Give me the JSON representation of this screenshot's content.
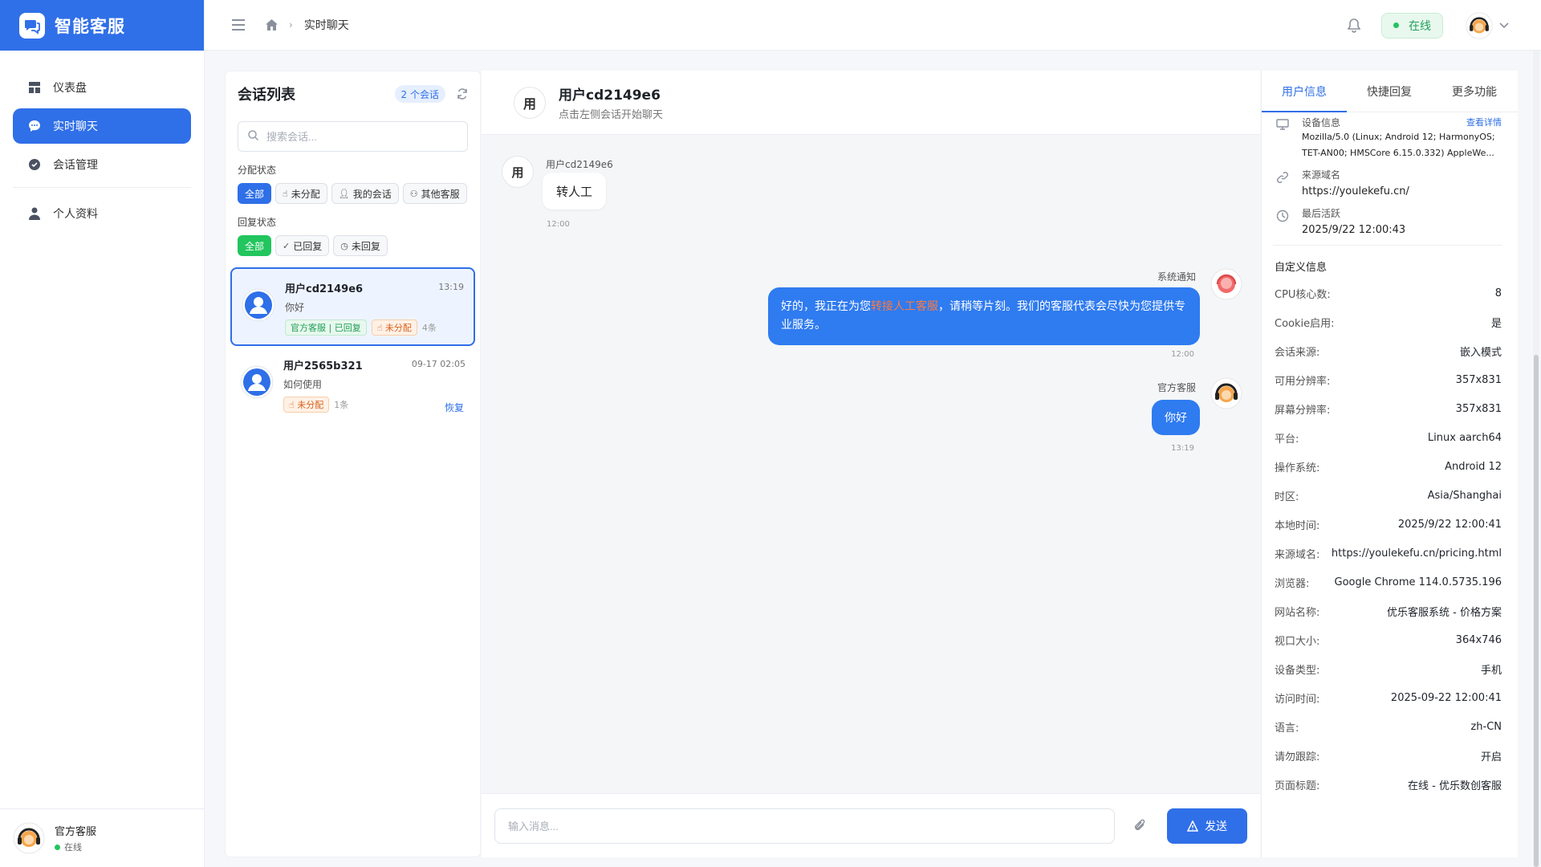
{
  "app": {
    "name": "智能客服"
  },
  "sidebar": {
    "items": [
      {
        "label": "仪表盘"
      },
      {
        "label": "实时聊天"
      },
      {
        "label": "会话管理"
      },
      {
        "label": "个人资料"
      }
    ],
    "footer": {
      "name": "官方客服",
      "status": "在线"
    }
  },
  "header": {
    "breadcrumb": "实时聊天",
    "status": "在线"
  },
  "conversations": {
    "title": "会话列表",
    "count": "2 个会话",
    "search_placeholder": "搜索会话...",
    "assign_label": "分配状态",
    "assign_filters": [
      "全部",
      "未分配",
      "我的会话",
      "其他客服"
    ],
    "reply_label": "回复状态",
    "reply_filters": [
      "全部",
      "已回复",
      "未回复"
    ],
    "items": [
      {
        "name": "用户cd2149e6",
        "time": "13:19",
        "message": "你好",
        "tag1": "官方客服 | 已回复",
        "tag2": "未分配",
        "count": "4条"
      },
      {
        "name": "用户2565b321",
        "time": "09-17 02:05",
        "message": "如何使用",
        "tag2": "未分配",
        "count": "1条",
        "action": "恢复"
      }
    ]
  },
  "chat": {
    "avatar_char": "用",
    "user_name": "用户cd2149e6",
    "subtitle": "点击左侧会话开始聊天",
    "messages": {
      "m1": {
        "sender": "用户cd2149e6",
        "text": "转人工",
        "time": "12:00"
      },
      "m2": {
        "sender": "系统通知",
        "text_a": "好的，我正在为您",
        "text_hl": "转接人工客服",
        "text_b": "，请稍等片刻。我们的客服代表会尽快为您提供专业服务。",
        "time": "12:00"
      },
      "m3": {
        "sender": "官方客服",
        "text": "你好",
        "time": "13:19"
      }
    },
    "input_placeholder": "输入消息...",
    "send_label": "发送"
  },
  "info": {
    "tabs": [
      "用户信息",
      "快捷回复",
      "更多功能"
    ],
    "device_label": "设备信息",
    "device_link": "查看详情",
    "device_ua": "Mozilla/5.0 (Linux; Android 12; HarmonyOS; TET-AN00; HMSCore 6.15.0.332) AppleWe...",
    "source_label": "来源域名",
    "source_value": "https://youlekefu.cn/",
    "last_active_label": "最后活跃",
    "last_active_value": "2025/9/22 12:00:43",
    "custom_title": "自定义信息",
    "fields": [
      {
        "k": "CPU核心数:",
        "v": "8"
      },
      {
        "k": "Cookie启用:",
        "v": "是"
      },
      {
        "k": "会话来源:",
        "v": "嵌入模式"
      },
      {
        "k": "可用分辨率:",
        "v": "357x831"
      },
      {
        "k": "屏幕分辨率:",
        "v": "357x831"
      },
      {
        "k": "平台:",
        "v": "Linux aarch64"
      },
      {
        "k": "操作系统:",
        "v": "Android 12"
      },
      {
        "k": "时区:",
        "v": "Asia/Shanghai"
      },
      {
        "k": "本地时间:",
        "v": "2025/9/22 12:00:41"
      },
      {
        "k": "来源域名:",
        "v": "https://youlekefu.cn/pricing.html"
      },
      {
        "k": "浏览器:",
        "v": "Google Chrome 114.0.5735.196"
      },
      {
        "k": "网站名称:",
        "v": "优乐客服系统 - 价格方案"
      },
      {
        "k": "视口大小:",
        "v": "364x746"
      },
      {
        "k": "设备类型:",
        "v": "手机"
      },
      {
        "k": "访问时间:",
        "v": "2025-09-22 12:00:41"
      },
      {
        "k": "语言:",
        "v": "zh-CN"
      },
      {
        "k": "请勿跟踪:",
        "v": "开启"
      },
      {
        "k": "页面标题:",
        "v": "在线 - 优乐数创客服"
      }
    ]
  },
  "colors": {
    "primary": "#2f6fe8",
    "success": "#22c55e",
    "highlight": "#ff7a3d"
  }
}
